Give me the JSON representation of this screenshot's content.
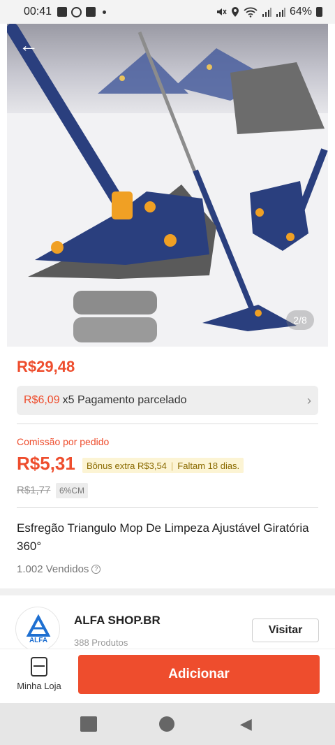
{
  "status_bar": {
    "time": "00:41",
    "battery": "64%",
    "icons_left": [
      "gallery-icon",
      "b-icon",
      "store-icon"
    ],
    "icons_right": [
      "mute-icon",
      "location-icon",
      "wifi-icon",
      "signal-icon",
      "signal-icon",
      "battery-icon"
    ]
  },
  "hero": {
    "image_counter": "2/8"
  },
  "price": {
    "current": "R$29,48",
    "installment_amount": "R$6,09",
    "installment_text": "x5 Pagamento parcelado"
  },
  "commission": {
    "label": "Comissão por pedido",
    "value": "R$5,31",
    "bonus_text": "Bônus extra R$3,54",
    "days_left": "Faltam 18 dias.",
    "old_value": "R$1,77",
    "rate_tag": "6%CM"
  },
  "product": {
    "title": "Esfregão Triangulo Mop De Limpeza Ajustável Giratória 360°",
    "sold": "1.002 Vendidos"
  },
  "shop": {
    "name": "ALFA SHOP.BR",
    "products": "388 Produtos",
    "visit_label": "Visitar",
    "logo_text": "ALFA"
  },
  "actions": {
    "my_store_label": "Minha Loja",
    "add_label": "Adicionar"
  },
  "colors": {
    "accent": "#ee4d2d",
    "mop_blue": "#2a3f7e",
    "mop_orange": "#f0a024"
  }
}
